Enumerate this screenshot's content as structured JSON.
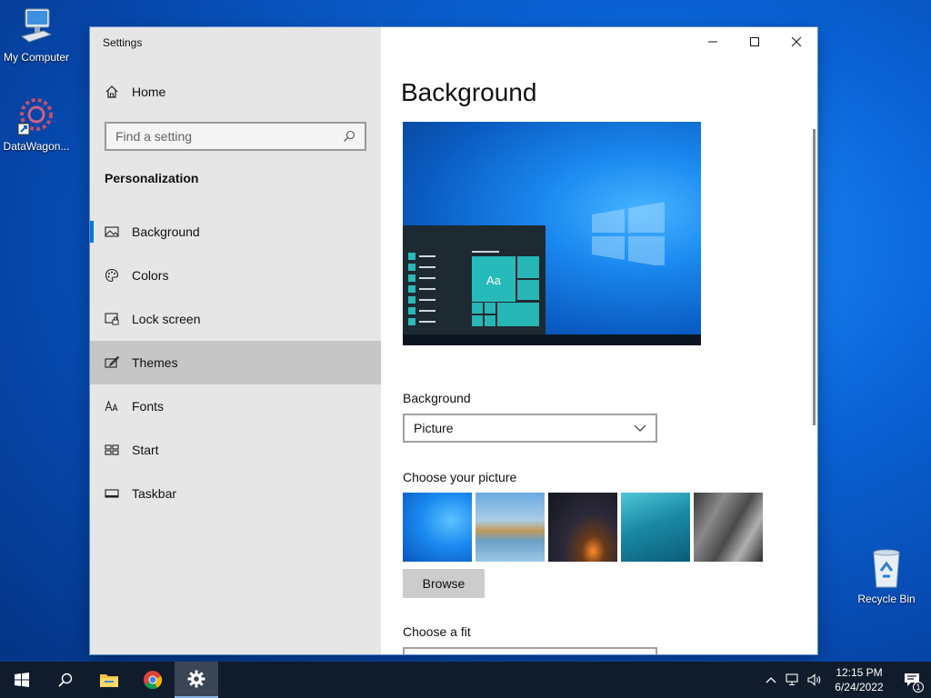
{
  "desktop": {
    "icons": [
      {
        "label": "My Computer"
      },
      {
        "label": "DataWagon..."
      },
      {
        "label": "Recycle Bin"
      }
    ]
  },
  "window": {
    "title": "Settings",
    "sidebar": {
      "home_label": "Home",
      "search_placeholder": "Find a setting",
      "section_title": "Personalization",
      "items": [
        {
          "label": "Background",
          "icon": "picture-icon"
        },
        {
          "label": "Colors",
          "icon": "palette-icon"
        },
        {
          "label": "Lock screen",
          "icon": "lock-screen-icon"
        },
        {
          "label": "Themes",
          "icon": "brush-icon"
        },
        {
          "label": "Fonts",
          "icon": "fonts-icon"
        },
        {
          "label": "Start",
          "icon": "start-icon"
        },
        {
          "label": "Taskbar",
          "icon": "taskbar-icon"
        }
      ],
      "active_item": "Background",
      "hovered_item": "Themes"
    },
    "content": {
      "page_title": "Background",
      "preview_tile_text": "Aa",
      "background_label": "Background",
      "background_value": "Picture",
      "choose_picture_label": "Choose your picture",
      "browse_label": "Browse",
      "choose_fit_label": "Choose a fit"
    }
  },
  "taskbar": {
    "time": "12:15 PM",
    "date": "6/24/2022",
    "notification_count": "1"
  },
  "colors": {
    "accent": "#0078d4",
    "sidebar_bg": "#e6e6e6",
    "taskbar_bg": "#101b2b"
  }
}
